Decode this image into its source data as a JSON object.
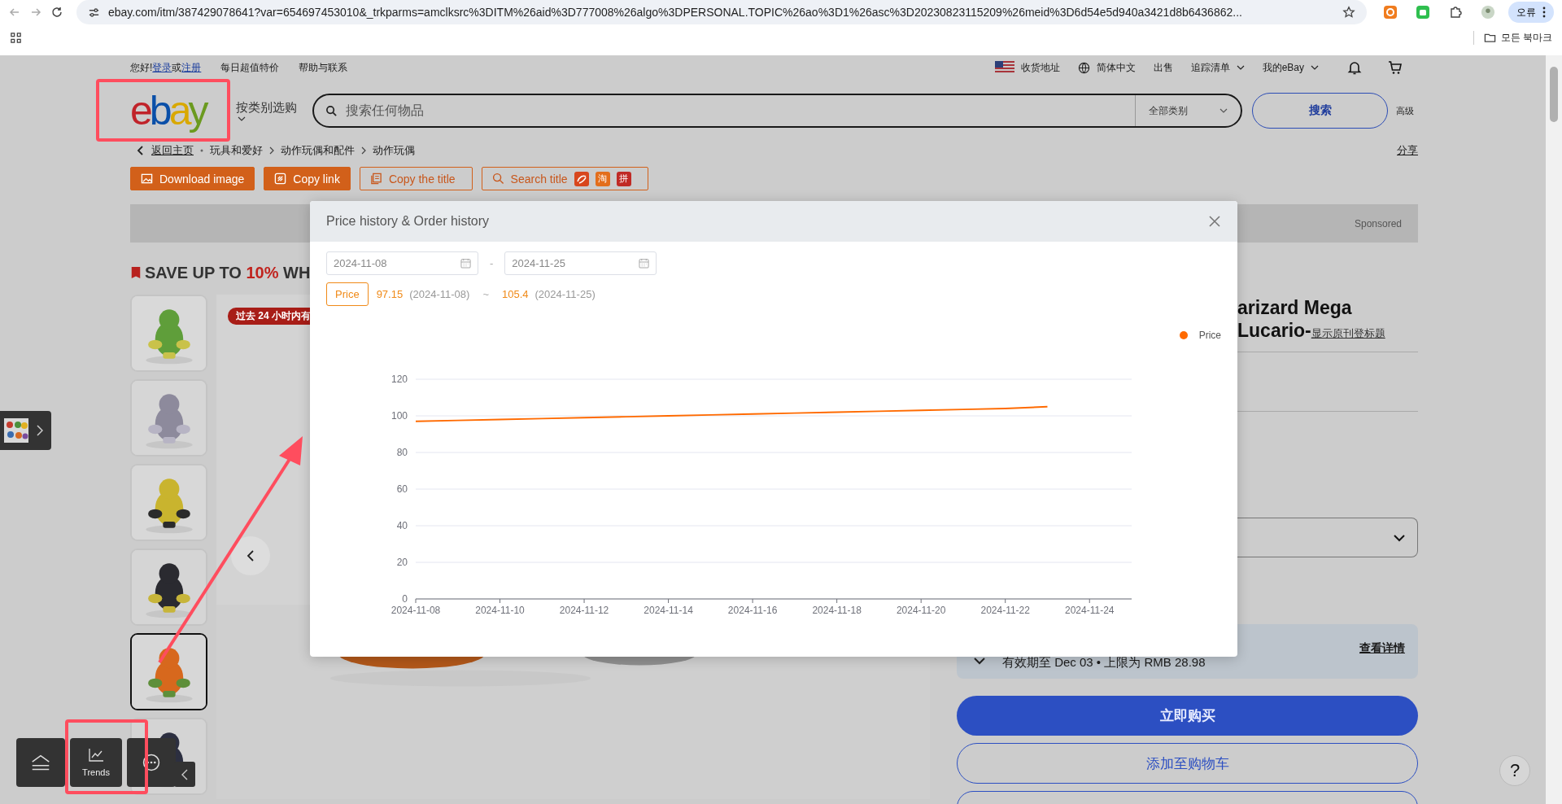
{
  "browser": {
    "url": "ebay.com/itm/387429078641?var=654697453010&_trkparms=amclksrc%3DITM%26aid%3D777008%26algo%3DPERSONAL.TOPIC%26ao%3D1%26asc%3D20230823115209%26meid%3D6d54e5d940a3421d8b6436862...",
    "profile": "오류",
    "bookmarks_label": "모든 북마크"
  },
  "site_nav": {
    "greeting": "您好!",
    "login": "登录",
    "or": "或",
    "register": "注册",
    "links": [
      "每日超值特价",
      "帮助与联系"
    ],
    "right_links": [
      {
        "label": "收货地址",
        "kind": "flag"
      },
      {
        "label": "简体中文",
        "kind": "globe"
      },
      {
        "label": "出售",
        "kind": "plain"
      },
      {
        "label": "追踪清单",
        "kind": "caret"
      },
      {
        "label": "我的eBay",
        "kind": "caret"
      }
    ]
  },
  "header": {
    "logo": "ebay",
    "shop_by_category": "按类别选购",
    "search_placeholder": "搜索任何物品",
    "category": "全部类别",
    "search_button": "搜索",
    "advanced": "高级"
  },
  "breadcrumb": {
    "back": "返回主页",
    "items": [
      "玩具和爱好",
      "动作玩偶和配件",
      "动作玩偶"
    ],
    "share": "分享"
  },
  "tool_buttons": [
    {
      "label": "Download image",
      "kind": "filled"
    },
    {
      "label": "Copy link",
      "kind": "filled"
    },
    {
      "label": "Copy the title",
      "kind": "outline"
    },
    {
      "label": "Search title",
      "kind": "search"
    }
  ],
  "search_badges": [
    "淘",
    "拼"
  ],
  "sponsored": "Sponsored",
  "promo": {
    "prefix": "SAVE UP TO ",
    "highlight": "10%",
    "suffix": " WH"
  },
  "recent_badge": "过去 24 小时内有",
  "thumbnails": [
    {
      "selected": false
    },
    {
      "selected": false
    },
    {
      "selected": false
    },
    {
      "selected": false
    },
    {
      "selected": true
    },
    {
      "selected": false
    }
  ],
  "product": {
    "title_lines": [
      "arizard Mega",
      "Lucario-"
    ],
    "original_title_link": "显示原刊登标题",
    "coupon": "有效期至 Dec 03 • 上限为 RMB 28.98",
    "coupon_link": "查看详情",
    "buy_now": "立即购买",
    "add_to_cart": "添加至购物车"
  },
  "floating_toolbar": {
    "trends": "Trends"
  },
  "help": "?",
  "modal": {
    "title": "Price history & Order history",
    "start_date": "2024-11-08",
    "date_separator": "-",
    "end_date": "2024-11-25",
    "metric_tab": "Price",
    "min_value": "97.15",
    "min_date": "(2024-11-08)",
    "range_separator": "~",
    "max_value": "105.4",
    "max_date": "(2024-11-25)",
    "chart_data": {
      "type": "line",
      "categories": [
        "2024-11-08",
        null,
        "2024-11-10",
        null,
        "2024-11-12",
        null,
        "2024-11-14",
        null,
        "2024-11-16",
        null,
        "2024-11-18",
        null,
        "2024-11-20",
        null,
        "2024-11-22",
        null,
        "2024-11-24",
        null
      ],
      "series": [
        {
          "name": "Price",
          "color": "#ff6a00",
          "values": [
            97,
            97.5,
            98,
            98.5,
            99,
            99.5,
            100,
            100.5,
            101,
            101.5,
            102,
            102.5,
            103,
            103.5,
            104,
            105,
            null,
            null
          ]
        }
      ],
      "ylim": [
        0,
        120
      ],
      "grid": true,
      "yticks": [
        0,
        20,
        40,
        60,
        80,
        100,
        120
      ]
    }
  }
}
